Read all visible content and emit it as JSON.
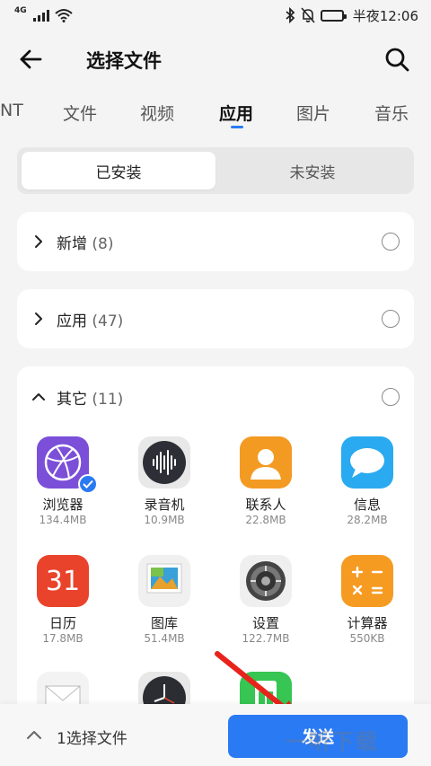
{
  "status": {
    "network": "4G",
    "time": "半夜12:06"
  },
  "header": {
    "title": "选择文件"
  },
  "tabs": [
    {
      "label": "NT"
    },
    {
      "label": "文件"
    },
    {
      "label": "视频"
    },
    {
      "label": "应用",
      "active": true
    },
    {
      "label": "图片"
    },
    {
      "label": "音乐"
    }
  ],
  "segment": {
    "installed": "已安装",
    "not_installed": "未安装"
  },
  "groups": [
    {
      "label": "新增",
      "count": "(8)"
    },
    {
      "label": "应用",
      "count": "(47)"
    },
    {
      "label": "其它",
      "count": "(11)"
    }
  ],
  "apps": [
    {
      "name": "浏览器",
      "size": "134.4MB",
      "icon": "browser-icon",
      "color": "#7b4fd8",
      "selected": true
    },
    {
      "name": "录音机",
      "size": "10.9MB",
      "icon": "recorder-icon",
      "color": "#2e2f36"
    },
    {
      "name": "联系人",
      "size": "22.8MB",
      "icon": "contacts-icon",
      "color": "#f39a22"
    },
    {
      "name": "信息",
      "size": "28.2MB",
      "icon": "messages-icon",
      "color": "#2aaaf0"
    },
    {
      "name": "日历",
      "size": "17.8MB",
      "icon": "calendar-icon",
      "color": "#e9432c",
      "text": "31"
    },
    {
      "name": "图库",
      "size": "51.4MB",
      "icon": "gallery-icon",
      "color": "#f0f0f0"
    },
    {
      "name": "设置",
      "size": "122.7MB",
      "icon": "settings-icon",
      "color": "#efefef"
    },
    {
      "name": "计算器",
      "size": "550KB",
      "icon": "calculator-icon",
      "color": "#f59b22"
    },
    {
      "name": "",
      "size": "",
      "icon": "email-icon",
      "color": "#f3f3f3"
    },
    {
      "name": "",
      "size": "",
      "icon": "clock-icon",
      "color": "#2b2d33"
    },
    {
      "name": "",
      "size": "",
      "icon": "sim-icon",
      "color": "#37c553"
    }
  ],
  "bottom": {
    "selected_text": "1选择文件",
    "send_label": "发送"
  },
  "watermark": "一听下载",
  "colors": {
    "accent": "#2a7af3",
    "background": "#f4f4f4"
  }
}
